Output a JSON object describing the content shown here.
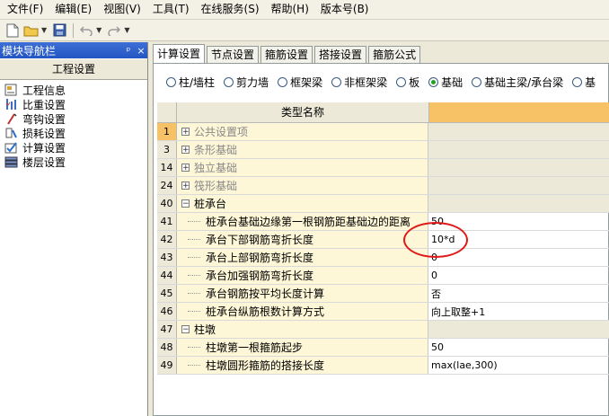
{
  "menu": [
    "文件(F)",
    "编辑(E)",
    "视图(V)",
    "工具(T)",
    "在线服务(S)",
    "帮助(H)",
    "版本号(B)"
  ],
  "toolbar": {
    "icons": [
      "new-file-icon",
      "open-folder-icon",
      "save-icon",
      "undo-icon",
      "redo-icon"
    ]
  },
  "left_panel": {
    "title": "模块导航栏",
    "pin": "ᵖ",
    "close": "×",
    "header": "工程设置",
    "items": [
      {
        "label": "工程信息",
        "icon": "info-icon"
      },
      {
        "label": "比重设置",
        "icon": "weight-icon"
      },
      {
        "label": "弯钩设置",
        "icon": "hook-icon"
      },
      {
        "label": "损耗设置",
        "icon": "loss-icon"
      },
      {
        "label": "计算设置",
        "icon": "calc-icon"
      },
      {
        "label": "楼层设置",
        "icon": "floor-icon"
      }
    ]
  },
  "tabs": [
    "计算设置",
    "节点设置",
    "箍筋设置",
    "搭接设置",
    "箍筋公式"
  ],
  "radios": [
    {
      "label": "柱/墙柱",
      "checked": false
    },
    {
      "label": "剪力墙",
      "checked": false
    },
    {
      "label": "框架梁",
      "checked": false
    },
    {
      "label": "非框架梁",
      "checked": false
    },
    {
      "label": "板",
      "checked": false
    },
    {
      "label": "基础",
      "checked": true
    },
    {
      "label": "基础主梁/承台梁",
      "checked": false
    },
    {
      "label": "基",
      "checked": false
    }
  ],
  "grid": {
    "header": "类型名称",
    "rows": [
      {
        "num": "1",
        "name": "公共设置项",
        "value": "",
        "kind": "category",
        "expander": "+"
      },
      {
        "num": "3",
        "name": "条形基础",
        "value": "",
        "kind": "category",
        "expander": "+"
      },
      {
        "num": "14",
        "name": "独立基础",
        "value": "",
        "kind": "category",
        "expander": "+"
      },
      {
        "num": "24",
        "name": "筏形基础",
        "value": "",
        "kind": "category",
        "expander": "+"
      },
      {
        "num": "40",
        "name": "桩承台",
        "value": "",
        "kind": "category",
        "expander": "−"
      },
      {
        "num": "41",
        "name": "桩承台基础边缘第一根钢筋距基础边的距离",
        "value": "50",
        "kind": "child"
      },
      {
        "num": "42",
        "name": "承台下部钢筋弯折长度",
        "value": "10*d",
        "kind": "child"
      },
      {
        "num": "43",
        "name": "承台上部钢筋弯折长度",
        "value": "0",
        "kind": "child"
      },
      {
        "num": "44",
        "name": "承台加强钢筋弯折长度",
        "value": "0",
        "kind": "child"
      },
      {
        "num": "45",
        "name": "承台钢筋按平均长度计算",
        "value": "否",
        "kind": "child"
      },
      {
        "num": "46",
        "name": "桩承台纵筋根数计算方式",
        "value": "向上取整+1",
        "kind": "child"
      },
      {
        "num": "47",
        "name": "柱墩",
        "value": "",
        "kind": "category",
        "expander": "−"
      },
      {
        "num": "48",
        "name": "柱墩第一根箍筋起步",
        "value": "50",
        "kind": "child"
      },
      {
        "num": "49",
        "name": "柱墩圆形箍筋的搭接长度",
        "value": "max(lae,300)",
        "kind": "child"
      }
    ]
  },
  "colors": {
    "accent": "#f7c265",
    "title_bar": "#2456c4",
    "highlight_circle": "#e01818"
  }
}
